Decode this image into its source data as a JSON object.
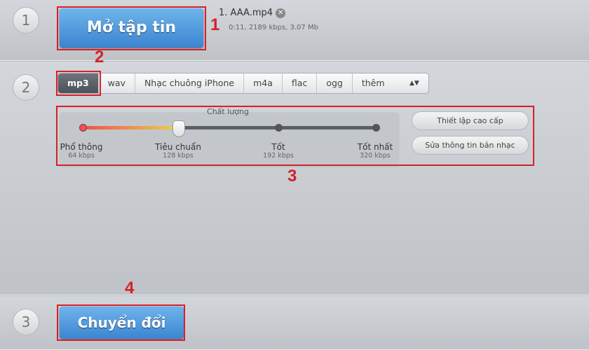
{
  "step1": {
    "number": "1",
    "open_label": "Mở tập tin",
    "file_name": "1. AAA.mp4",
    "file_info": "0:11, 2189 kbps, 3.07 Mb"
  },
  "step2": {
    "number": "2",
    "tabs": [
      "mp3",
      "wav",
      "Nhạc chuông iPhone",
      "m4a",
      "flac",
      "ogg",
      "thêm"
    ],
    "selected_tab": "mp3",
    "quality": {
      "title": "Chất lượng",
      "selected_index": 1,
      "levels": [
        {
          "name": "Phổ thông",
          "rate": "64 kbps"
        },
        {
          "name": "Tiêu chuẩn",
          "rate": "128 kbps"
        },
        {
          "name": "Tốt",
          "rate": "192 kbps"
        },
        {
          "name": "Tốt nhất",
          "rate": "320 kbps"
        }
      ]
    },
    "advanced_label": "Thiết lập cao cấp",
    "edit_tags_label": "Sửa thông tin bản nhạc"
  },
  "step3": {
    "number": "3",
    "convert_label": "Chuyển đổi"
  },
  "annotations": [
    "1",
    "2",
    "3",
    "4"
  ],
  "colors": {
    "annotation": "#d6202a",
    "button": "#3a85d0"
  }
}
